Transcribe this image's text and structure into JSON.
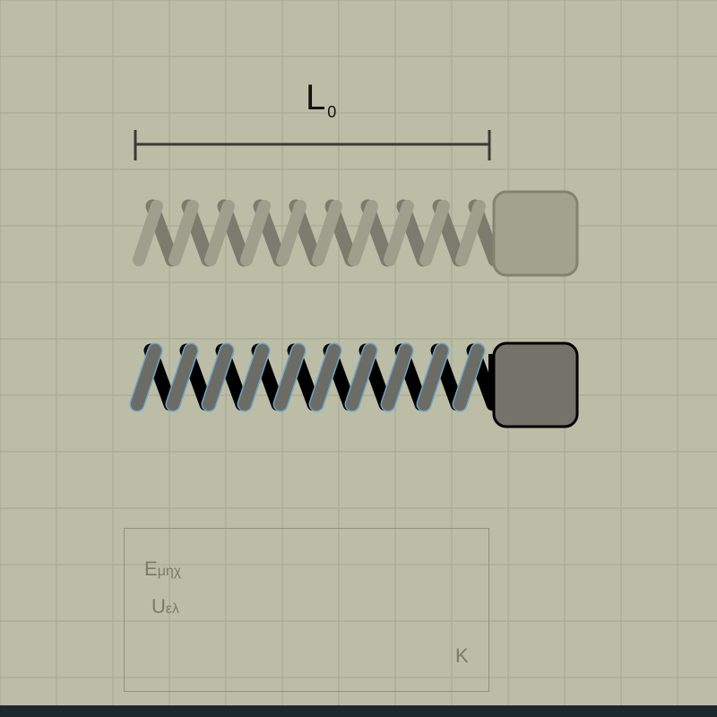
{
  "colors": {
    "background": "#bcbda6",
    "grid": "#a9aa92",
    "measure_line": "#3a3b33",
    "ghost_spring": "#9d9e8b",
    "ghost_spring_back": "#78796a",
    "spring_front": "#6b6c66",
    "spring_back": "#000000",
    "spring_outline": "#6fa3c4",
    "block_fill": "#74736a",
    "ghost_block_fill": "#a3a28f",
    "panel_text": "#7a7b6a",
    "bottom_bar": "#1e272b"
  },
  "measure": {
    "symbol": "L",
    "subscript": "0"
  },
  "springs": {
    "coils": 10
  },
  "energy_panel": {
    "row1": {
      "main": "E",
      "sub": "μηχ"
    },
    "row2": {
      "main": "U",
      "sub": "ελ"
    },
    "k_label": "K"
  }
}
